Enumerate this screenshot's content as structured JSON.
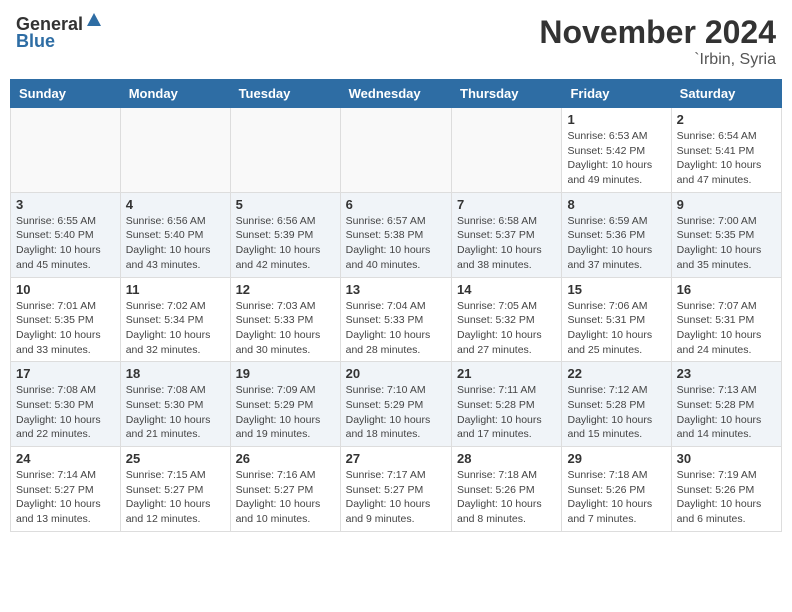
{
  "header": {
    "logo_general": "General",
    "logo_blue": "Blue",
    "month": "November 2024",
    "location": "`Irbin, Syria"
  },
  "weekdays": [
    "Sunday",
    "Monday",
    "Tuesday",
    "Wednesday",
    "Thursday",
    "Friday",
    "Saturday"
  ],
  "weeks": [
    [
      {
        "day": "",
        "info": ""
      },
      {
        "day": "",
        "info": ""
      },
      {
        "day": "",
        "info": ""
      },
      {
        "day": "",
        "info": ""
      },
      {
        "day": "",
        "info": ""
      },
      {
        "day": "1",
        "info": "Sunrise: 6:53 AM\nSunset: 5:42 PM\nDaylight: 10 hours and 49 minutes."
      },
      {
        "day": "2",
        "info": "Sunrise: 6:54 AM\nSunset: 5:41 PM\nDaylight: 10 hours and 47 minutes."
      }
    ],
    [
      {
        "day": "3",
        "info": "Sunrise: 6:55 AM\nSunset: 5:40 PM\nDaylight: 10 hours and 45 minutes."
      },
      {
        "day": "4",
        "info": "Sunrise: 6:56 AM\nSunset: 5:40 PM\nDaylight: 10 hours and 43 minutes."
      },
      {
        "day": "5",
        "info": "Sunrise: 6:56 AM\nSunset: 5:39 PM\nDaylight: 10 hours and 42 minutes."
      },
      {
        "day": "6",
        "info": "Sunrise: 6:57 AM\nSunset: 5:38 PM\nDaylight: 10 hours and 40 minutes."
      },
      {
        "day": "7",
        "info": "Sunrise: 6:58 AM\nSunset: 5:37 PM\nDaylight: 10 hours and 38 minutes."
      },
      {
        "day": "8",
        "info": "Sunrise: 6:59 AM\nSunset: 5:36 PM\nDaylight: 10 hours and 37 minutes."
      },
      {
        "day": "9",
        "info": "Sunrise: 7:00 AM\nSunset: 5:35 PM\nDaylight: 10 hours and 35 minutes."
      }
    ],
    [
      {
        "day": "10",
        "info": "Sunrise: 7:01 AM\nSunset: 5:35 PM\nDaylight: 10 hours and 33 minutes."
      },
      {
        "day": "11",
        "info": "Sunrise: 7:02 AM\nSunset: 5:34 PM\nDaylight: 10 hours and 32 minutes."
      },
      {
        "day": "12",
        "info": "Sunrise: 7:03 AM\nSunset: 5:33 PM\nDaylight: 10 hours and 30 minutes."
      },
      {
        "day": "13",
        "info": "Sunrise: 7:04 AM\nSunset: 5:33 PM\nDaylight: 10 hours and 28 minutes."
      },
      {
        "day": "14",
        "info": "Sunrise: 7:05 AM\nSunset: 5:32 PM\nDaylight: 10 hours and 27 minutes."
      },
      {
        "day": "15",
        "info": "Sunrise: 7:06 AM\nSunset: 5:31 PM\nDaylight: 10 hours and 25 minutes."
      },
      {
        "day": "16",
        "info": "Sunrise: 7:07 AM\nSunset: 5:31 PM\nDaylight: 10 hours and 24 minutes."
      }
    ],
    [
      {
        "day": "17",
        "info": "Sunrise: 7:08 AM\nSunset: 5:30 PM\nDaylight: 10 hours and 22 minutes."
      },
      {
        "day": "18",
        "info": "Sunrise: 7:08 AM\nSunset: 5:30 PM\nDaylight: 10 hours and 21 minutes."
      },
      {
        "day": "19",
        "info": "Sunrise: 7:09 AM\nSunset: 5:29 PM\nDaylight: 10 hours and 19 minutes."
      },
      {
        "day": "20",
        "info": "Sunrise: 7:10 AM\nSunset: 5:29 PM\nDaylight: 10 hours and 18 minutes."
      },
      {
        "day": "21",
        "info": "Sunrise: 7:11 AM\nSunset: 5:28 PM\nDaylight: 10 hours and 17 minutes."
      },
      {
        "day": "22",
        "info": "Sunrise: 7:12 AM\nSunset: 5:28 PM\nDaylight: 10 hours and 15 minutes."
      },
      {
        "day": "23",
        "info": "Sunrise: 7:13 AM\nSunset: 5:28 PM\nDaylight: 10 hours and 14 minutes."
      }
    ],
    [
      {
        "day": "24",
        "info": "Sunrise: 7:14 AM\nSunset: 5:27 PM\nDaylight: 10 hours and 13 minutes."
      },
      {
        "day": "25",
        "info": "Sunrise: 7:15 AM\nSunset: 5:27 PM\nDaylight: 10 hours and 12 minutes."
      },
      {
        "day": "26",
        "info": "Sunrise: 7:16 AM\nSunset: 5:27 PM\nDaylight: 10 hours and 10 minutes."
      },
      {
        "day": "27",
        "info": "Sunrise: 7:17 AM\nSunset: 5:27 PM\nDaylight: 10 hours and 9 minutes."
      },
      {
        "day": "28",
        "info": "Sunrise: 7:18 AM\nSunset: 5:26 PM\nDaylight: 10 hours and 8 minutes."
      },
      {
        "day": "29",
        "info": "Sunrise: 7:18 AM\nSunset: 5:26 PM\nDaylight: 10 hours and 7 minutes."
      },
      {
        "day": "30",
        "info": "Sunrise: 7:19 AM\nSunset: 5:26 PM\nDaylight: 10 hours and 6 minutes."
      }
    ]
  ]
}
